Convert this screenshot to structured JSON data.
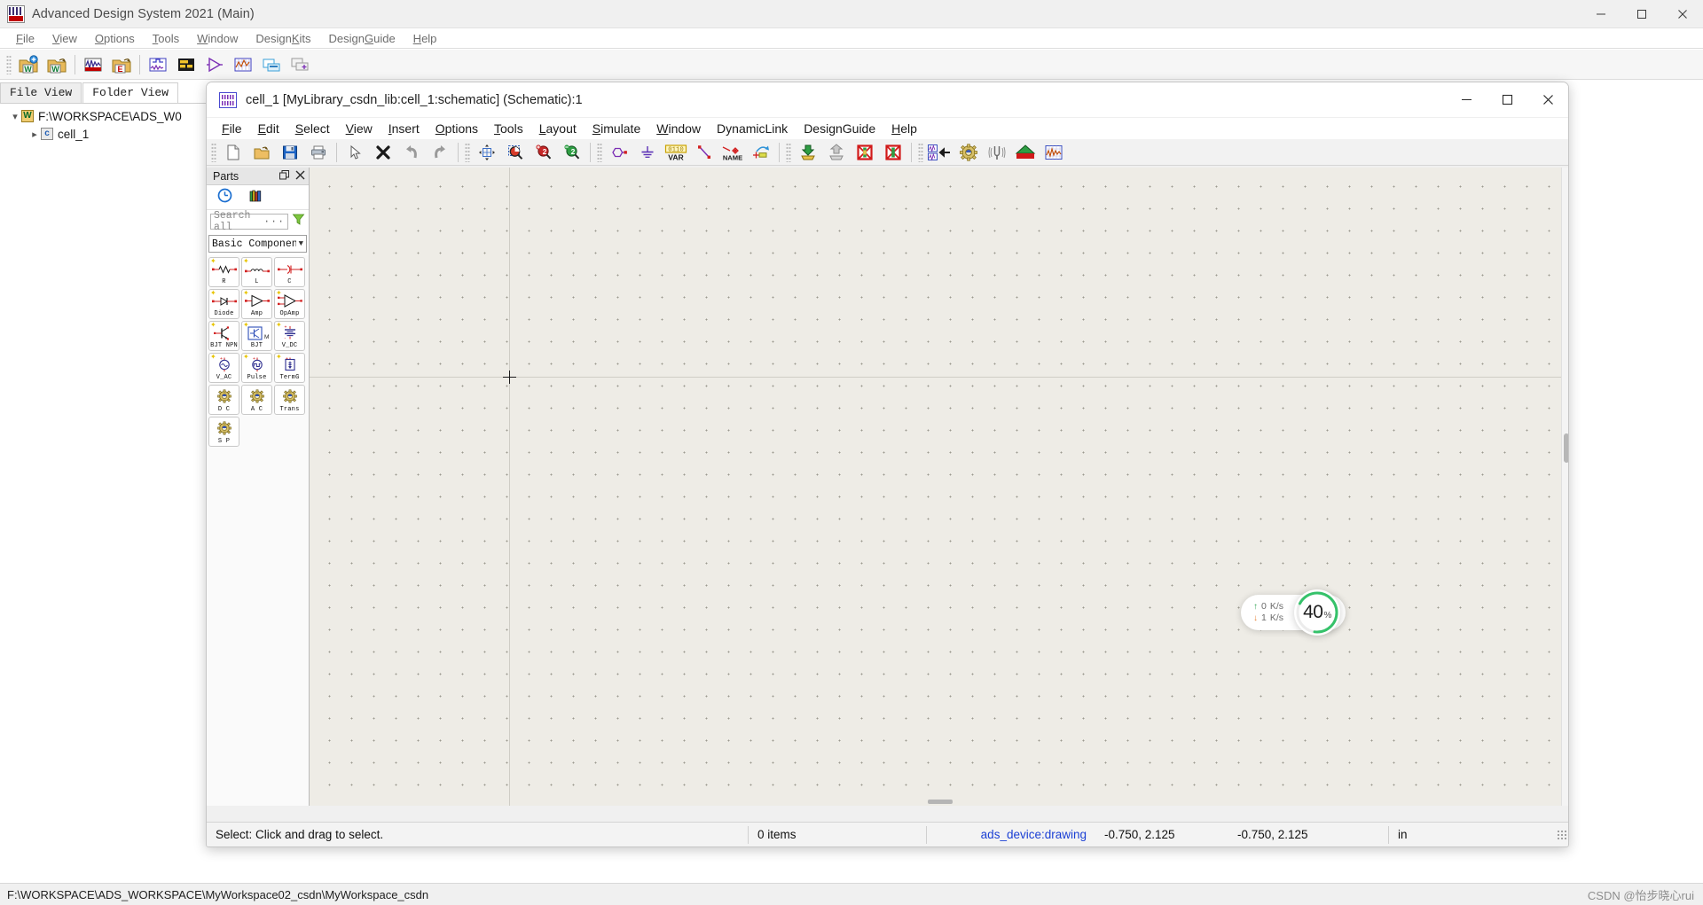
{
  "main_window": {
    "title": "Advanced Design System 2021 (Main)",
    "icon": "ads-app-icon",
    "window_buttons": [
      {
        "name": "minimize-button",
        "glyph": "minimize"
      },
      {
        "name": "maximize-button",
        "glyph": "maximize"
      },
      {
        "name": "close-button",
        "glyph": "close"
      }
    ],
    "menu": [
      {
        "label": "File",
        "accel": "F"
      },
      {
        "label": "View",
        "accel": "V"
      },
      {
        "label": "Options",
        "accel": "O"
      },
      {
        "label": "Tools",
        "accel": "T"
      },
      {
        "label": "Window",
        "accel": "W"
      },
      {
        "label": "DesignKits",
        "accel": "K"
      },
      {
        "label": "DesignGuide",
        "accel": "G"
      },
      {
        "label": "Help",
        "accel": "H"
      }
    ],
    "toolbar": [
      {
        "name": "new-workspace-button",
        "icon": "new-workspace-icon"
      },
      {
        "name": "open-workspace-button",
        "icon": "open-workspace-icon"
      },
      {
        "name": "new-schematic-button",
        "icon": "schematic-icon"
      },
      {
        "name": "open-design-button",
        "icon": "open-design-icon"
      },
      {
        "name": "new-layout-button",
        "icon": "layout-icon"
      },
      {
        "name": "new-symbol-button",
        "icon": "symbol-icon"
      },
      {
        "name": "new-ads-ptolemy-button",
        "icon": "amplifier-icon"
      },
      {
        "name": "new-data-display-button",
        "icon": "data-display-icon"
      },
      {
        "name": "library-manager-button",
        "icon": "library-icon"
      },
      {
        "name": "copy-design-button",
        "icon": "copy-design-icon"
      }
    ],
    "tabs": [
      {
        "label": "File View",
        "active": false,
        "name": "tab-file-view"
      },
      {
        "label": "Folder View",
        "active": true,
        "name": "tab-folder-view"
      }
    ],
    "tree": [
      {
        "level": 1,
        "label": "F:\\WORKSPACE\\ADS_W0",
        "chevron": "⌄",
        "badge": "W",
        "badge_type": "workspace"
      },
      {
        "level": 2,
        "label": "cell_1",
        "chevron": "›",
        "badge": "C",
        "badge_type": "cell"
      }
    ],
    "status_path": "F:\\WORKSPACE\\ADS_WORKSPACE\\MyWorkspace02_csdn\\MyWorkspace_csdn",
    "watermark": "CSDN @怡步晓心rui"
  },
  "schematic_window": {
    "title": "cell_1 [MyLibrary_csdn_lib:cell_1:schematic] (Schematic):1",
    "icon": "schematic-window-icon",
    "window_buttons": [
      {
        "name": "minimize-button",
        "glyph": "minimize"
      },
      {
        "name": "maximize-button",
        "glyph": "maximize"
      },
      {
        "name": "close-button",
        "glyph": "close"
      }
    ],
    "menu": [
      {
        "label": "File",
        "accel": "F"
      },
      {
        "label": "Edit",
        "accel": "E"
      },
      {
        "label": "Select",
        "accel": "S"
      },
      {
        "label": "View",
        "accel": "V"
      },
      {
        "label": "Insert",
        "accel": "I"
      },
      {
        "label": "Options",
        "accel": "O"
      },
      {
        "label": "Tools",
        "accel": "T"
      },
      {
        "label": "Layout",
        "accel": "L"
      },
      {
        "label": "Simulate",
        "accel": "S"
      },
      {
        "label": "Window",
        "accel": "W"
      },
      {
        "label": "DynamicLink",
        "accel": ""
      },
      {
        "label": "DesignGuide",
        "accel": ""
      },
      {
        "label": "Help",
        "accel": "H"
      }
    ],
    "toolbar": [
      {
        "name": "new-button",
        "icon": "new-file-icon"
      },
      {
        "name": "open-button",
        "icon": "open-folder-icon"
      },
      {
        "name": "save-button",
        "icon": "floppy-disk-icon"
      },
      {
        "name": "print-button",
        "icon": "printer-icon"
      },
      {
        "name": "select-arrow-button",
        "icon": "cursor-arrow-icon"
      },
      {
        "name": "delete-button",
        "icon": "x-delete-icon"
      },
      {
        "name": "undo-button",
        "icon": "undo-arrow-icon"
      },
      {
        "name": "redo-button",
        "icon": "redo-arrow-icon"
      },
      {
        "name": "zoom-pan-button",
        "icon": "pan-grid-icon"
      },
      {
        "name": "zoom-area-button",
        "icon": "zoom-area-icon"
      },
      {
        "name": "zoom-in-button",
        "icon": "zoom-in-icon"
      },
      {
        "name": "zoom-out-button",
        "icon": "zoom-out-icon"
      },
      {
        "name": "insert-component-button",
        "icon": "hexagon-port-icon"
      },
      {
        "name": "insert-ground-button",
        "icon": "ground-icon"
      },
      {
        "name": "insert-var-button",
        "icon": "var-icon"
      },
      {
        "name": "insert-wire-button",
        "icon": "wire-icon"
      },
      {
        "name": "insert-wire-name-button",
        "icon": "wire-name-icon"
      },
      {
        "name": "insert-pin-button",
        "icon": "pin-icon"
      },
      {
        "name": "push-into-hierarchy-button",
        "icon": "push-down-icon"
      },
      {
        "name": "pop-out-hierarchy-button",
        "icon": "pop-up-icon"
      },
      {
        "name": "deactivate-button",
        "icon": "deactivate-icon"
      },
      {
        "name": "activate-button",
        "icon": "activate-icon"
      },
      {
        "name": "generate-symbol-button",
        "icon": "generate-symbol-icon"
      },
      {
        "name": "simulation-settings-button",
        "icon": "gear-icon"
      },
      {
        "name": "tuning-button",
        "icon": "tuning-fork-icon"
      },
      {
        "name": "simulate-button",
        "icon": "green-arrow-icon"
      },
      {
        "name": "data-display-button",
        "icon": "data-display-icon"
      }
    ],
    "parts_panel": {
      "title": "Parts",
      "header_buttons": [
        {
          "name": "float-panel-button",
          "icon": "restore-window-icon"
        },
        {
          "name": "close-panel-button",
          "icon": "close-icon"
        }
      ],
      "icon_buttons": [
        {
          "name": "history-button",
          "icon": "clock-icon"
        },
        {
          "name": "library-button",
          "icon": "books-icon"
        }
      ],
      "search": {
        "placeholder": "Search all",
        "value": "",
        "ellipsis": "···"
      },
      "filter_button": {
        "name": "filter-button",
        "icon": "funnel-icon"
      },
      "category": {
        "selected": "Basic Components",
        "options": [
          "Basic Components"
        ]
      },
      "items": [
        {
          "label": "R",
          "symbol": "resistor",
          "favorite": true
        },
        {
          "label": "L",
          "symbol": "inductor",
          "favorite": true
        },
        {
          "label": "C",
          "symbol": "capacitor",
          "favorite": false
        },
        {
          "label": "Diode",
          "symbol": "diode",
          "favorite": true
        },
        {
          "label": "Amp",
          "symbol": "amp",
          "favorite": true
        },
        {
          "label": "OpAmp",
          "symbol": "opamp",
          "favorite": true
        },
        {
          "label": "BJT NPN",
          "symbol": "bjt-npn",
          "favorite": true
        },
        {
          "label": "BJT",
          "symbol": "bjt-model",
          "favorite": true
        },
        {
          "label": "V_DC",
          "symbol": "v-dc",
          "favorite": true
        },
        {
          "label": "V_AC",
          "symbol": "v-ac",
          "favorite": true
        },
        {
          "label": "Pulse",
          "symbol": "pulse",
          "favorite": true
        },
        {
          "label": "TermG",
          "symbol": "termg",
          "favorite": true
        },
        {
          "label": "D C",
          "symbol": "dc-sim",
          "favorite": false
        },
        {
          "label": "A C",
          "symbol": "ac-sim",
          "favorite": false
        },
        {
          "label": "Trans",
          "symbol": "trans-sim",
          "favorite": false
        },
        {
          "label": "S P",
          "symbol": "sp-sim",
          "favorite": false
        }
      ]
    },
    "status_bar": {
      "hint": "Select: Click and drag to select.",
      "item_count": "0 items",
      "layer": "ads_device:drawing",
      "coord_1": "-0.750, 2.125",
      "coord_2": "-0.750, 2.125",
      "units": "in"
    }
  },
  "net_widget": {
    "upload": "0",
    "upload_unit": "K/s",
    "download": "1",
    "download_unit": "K/s",
    "cpu_percent": "40",
    "cpu_unit": "%",
    "ring_color": "#35c26a"
  }
}
